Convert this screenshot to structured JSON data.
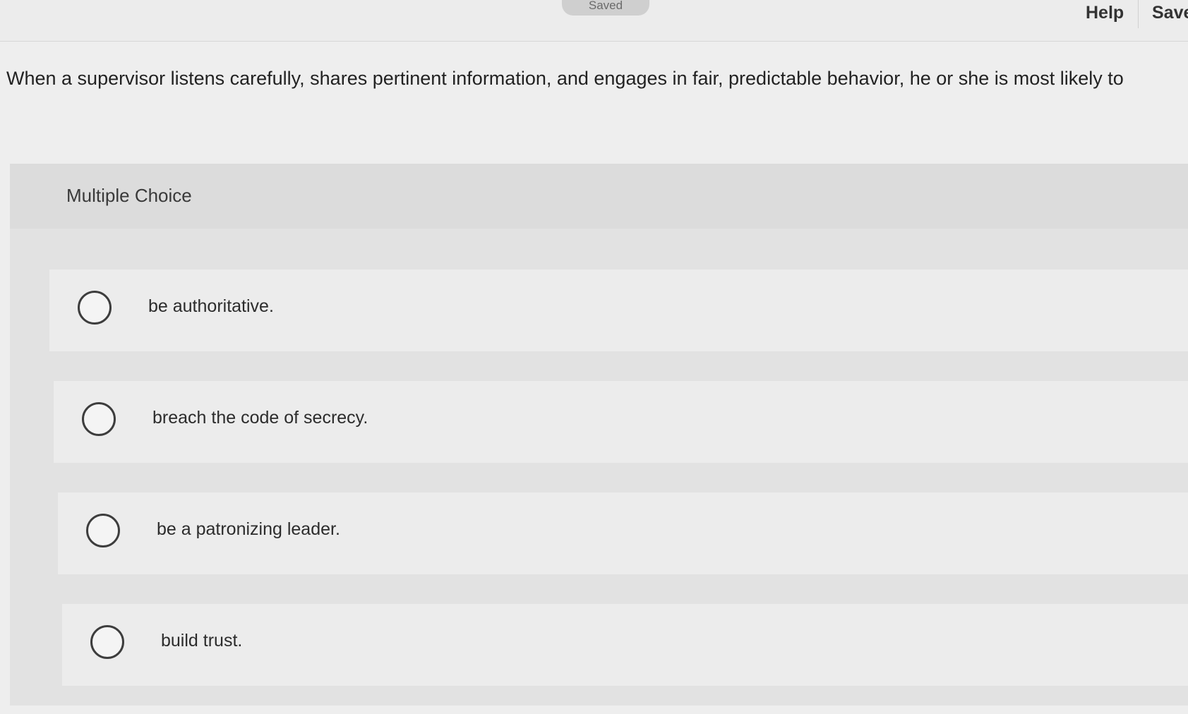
{
  "header": {
    "status": "Saved",
    "help_label": "Help",
    "save_label": "Save"
  },
  "question": {
    "text": "When a supervisor listens carefully, shares pertinent information, and engages in fair, predictable behavior, he or she is most likely to"
  },
  "choices": {
    "type_label": "Multiple Choice",
    "options": [
      {
        "label": "be authoritative."
      },
      {
        "label": "breach the code of secrecy."
      },
      {
        "label": "be a patronizing leader."
      },
      {
        "label": "build trust."
      }
    ]
  }
}
